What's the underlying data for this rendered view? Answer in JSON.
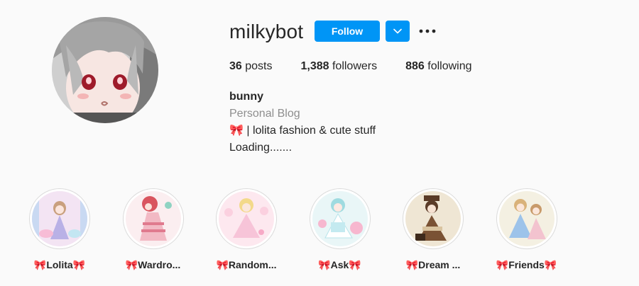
{
  "profile": {
    "username": "milkybot",
    "follow_label": "Follow",
    "dropdown_icon": "chevron-down-icon",
    "more_icon": "more-options-icon",
    "avatar_icon": "profile-avatar",
    "accent_color": "#0095f6"
  },
  "stats": {
    "posts_count": "36",
    "posts_label": " posts",
    "followers_count": "1,388",
    "followers_label": " followers",
    "following_count": "886",
    "following_label": " following"
  },
  "bio": {
    "name": "bunny",
    "category": "Personal Blog",
    "line1": "🎀 | lolita fashion & cute stuff",
    "line2": "Loading......."
  },
  "highlights": [
    {
      "label": "🎀Lolita🎀"
    },
    {
      "label": "🎀Wardro..."
    },
    {
      "label": "🎀Random..."
    },
    {
      "label": "🎀Ask🎀"
    },
    {
      "label": "🎀Dream ..."
    },
    {
      "label": "🎀Friends🎀"
    }
  ]
}
